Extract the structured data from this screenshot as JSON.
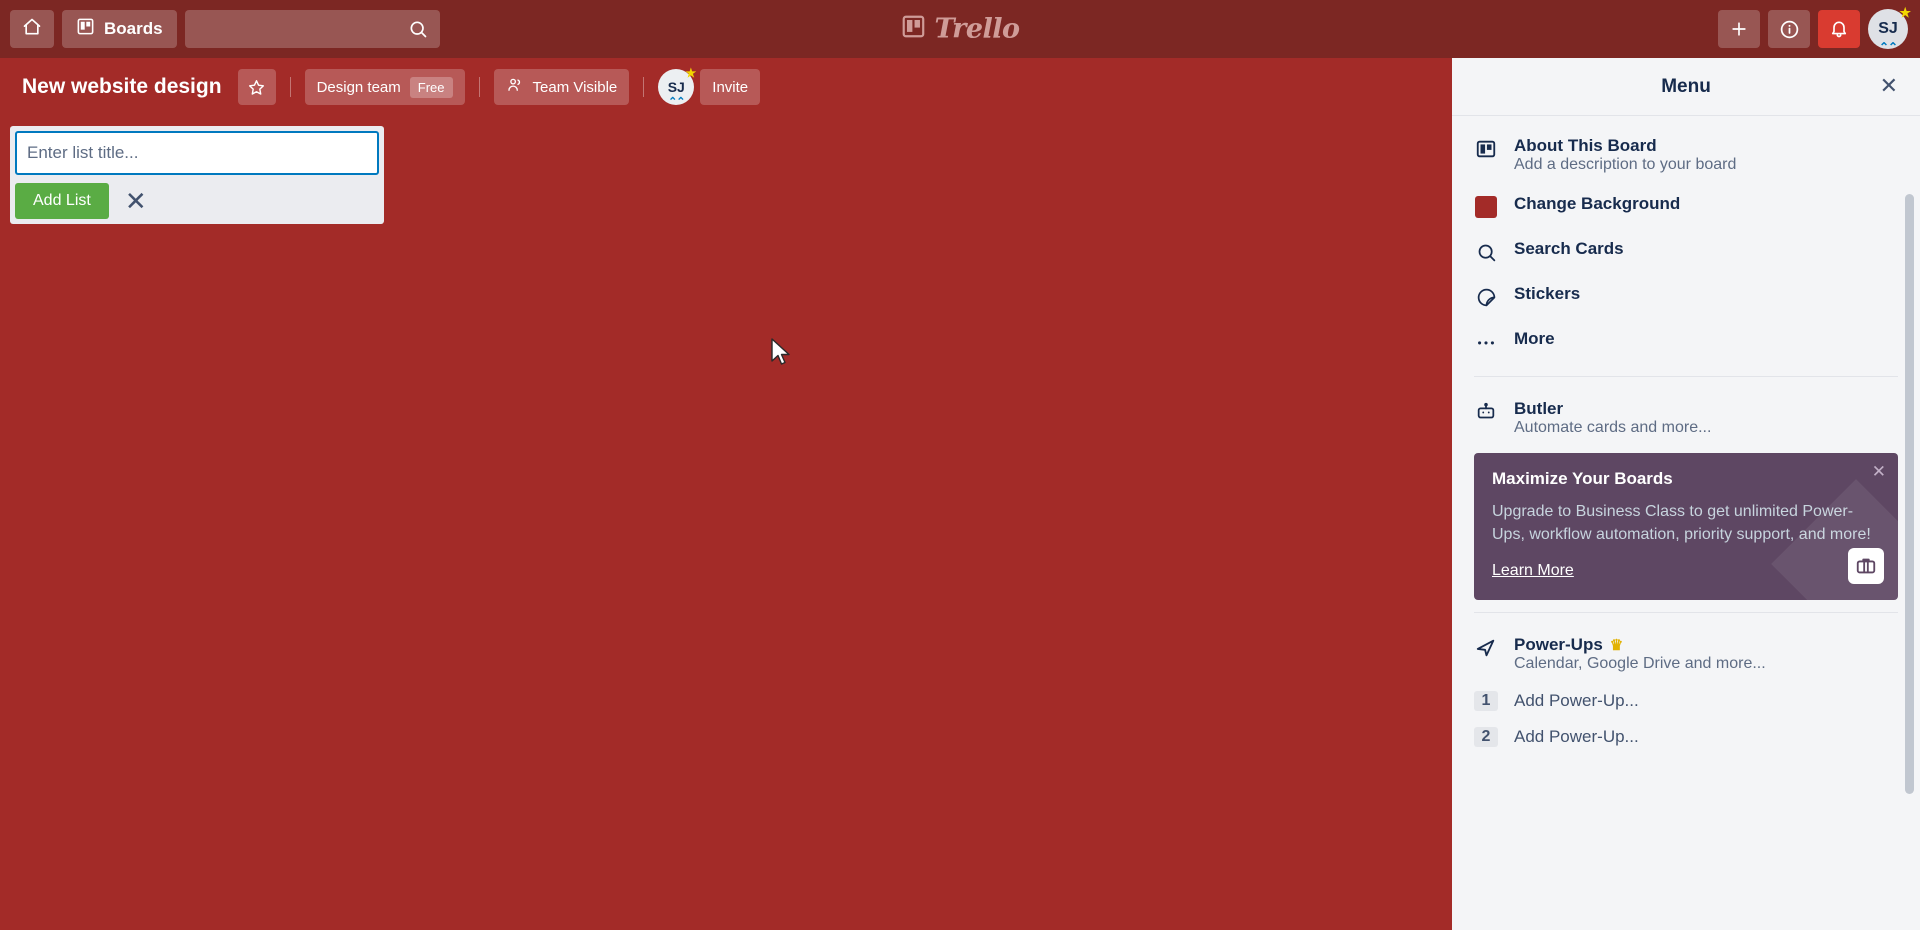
{
  "topbar": {
    "home_icon": "home-icon",
    "boards_label": "Boards",
    "boards_icon": "board-icon",
    "search_placeholder": "",
    "search_value": "",
    "search_icon": "search-icon",
    "logo_text": "Trello",
    "add_icon": "plus-icon",
    "info_icon": "info-icon",
    "notifications_icon": "bell-icon",
    "avatar_initials": "SJ"
  },
  "board": {
    "title": "New website design",
    "star_icon": "star-icon",
    "team_name": "Design team",
    "plan_badge": "Free",
    "visibility_label": "Team Visible",
    "visibility_icon": "people-icon",
    "member_initials": "SJ",
    "invite_label": "Invite"
  },
  "add_list": {
    "placeholder": "Enter list title...",
    "value": "",
    "submit_label": "Add List",
    "close_icon": "close-icon"
  },
  "menu": {
    "title": "Menu",
    "close_icon": "close-icon",
    "items": [
      {
        "icon": "board-icon",
        "label": "About This Board",
        "sub": "Add a description to your board"
      },
      {
        "icon": "color-swatch-icon",
        "label": "Change Background",
        "sub": ""
      },
      {
        "icon": "search-icon",
        "label": "Search Cards",
        "sub": ""
      },
      {
        "icon": "sticker-icon",
        "label": "Stickers",
        "sub": ""
      },
      {
        "icon": "ellipsis-icon",
        "label": "More",
        "sub": ""
      }
    ],
    "butler": {
      "icon": "robot-icon",
      "label": "Butler",
      "sub": "Automate cards and more..."
    },
    "upgrade": {
      "title": "Maximize Your Boards",
      "body": "Upgrade to Business Class to get unlimited Power-Ups, workflow automation, priority support, and more!",
      "link_label": "Learn More",
      "close_icon": "close-icon",
      "badge_icon": "briefcase-icon"
    },
    "powerups": {
      "icon": "rocket-icon",
      "label": "Power-Ups",
      "crown_icon": "crown-icon",
      "sub": "Calendar, Google Drive and more...",
      "rows": [
        {
          "num": "1",
          "label": "Add Power-Up..."
        },
        {
          "num": "2",
          "label": "Add Power-Up..."
        }
      ]
    }
  },
  "colors": {
    "board_background": "#a32b28",
    "topbar": "#7c2723",
    "menu_panel": "#f4f5f7",
    "upgrade_card": "#5e4763",
    "add_list_button": "#5aac44",
    "notification_alert": "#d93b30"
  }
}
